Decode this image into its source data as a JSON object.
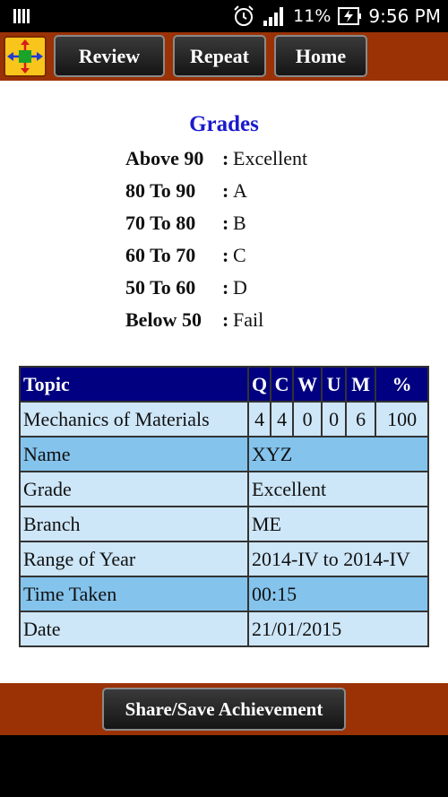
{
  "status_bar": {
    "battery": "11%",
    "time": "9:56 PM"
  },
  "toolbar": {
    "review_label": "Review",
    "repeat_label": "Repeat",
    "home_label": "Home"
  },
  "grades": {
    "title": "Grades",
    "rows": [
      {
        "range": "Above 90",
        "sep": ":",
        "grade": "Excellent"
      },
      {
        "range": "80 To 90",
        "sep": ":",
        "grade": "A"
      },
      {
        "range": "70 To 80",
        "sep": ":",
        "grade": "B"
      },
      {
        "range": "60 To 70",
        "sep": ":",
        "grade": "C"
      },
      {
        "range": "50 To 60",
        "sep": ":",
        "grade": "D"
      },
      {
        "range": "Below 50",
        "sep": ":",
        "grade": "Fail"
      }
    ]
  },
  "result": {
    "headers": [
      "Topic",
      "Q",
      "C",
      "W",
      "U",
      "M",
      "%"
    ],
    "score_row": [
      "Mechanics of Materials",
      "4",
      "4",
      "0",
      "0",
      "6",
      "100"
    ],
    "details": [
      {
        "label": "Name",
        "value": "XYZ"
      },
      {
        "label": "Grade",
        "value": "Excellent"
      },
      {
        "label": "Branch",
        "value": "ME"
      },
      {
        "label": "Range of Year",
        "value": "2014-IV to 2014-IV"
      },
      {
        "label": "Time Taken",
        "value": "00:15"
      },
      {
        "label": "Date",
        "value": "21/01/2015"
      }
    ]
  },
  "footer": {
    "share_label": "Share/Save Achievement"
  },
  "colors": {
    "toolbar_bg": "#9a3206",
    "header_bg": "#000080",
    "row_light": "#cde6f8",
    "row_dark": "#84c3ec",
    "title_blue": "#1a1acd"
  }
}
